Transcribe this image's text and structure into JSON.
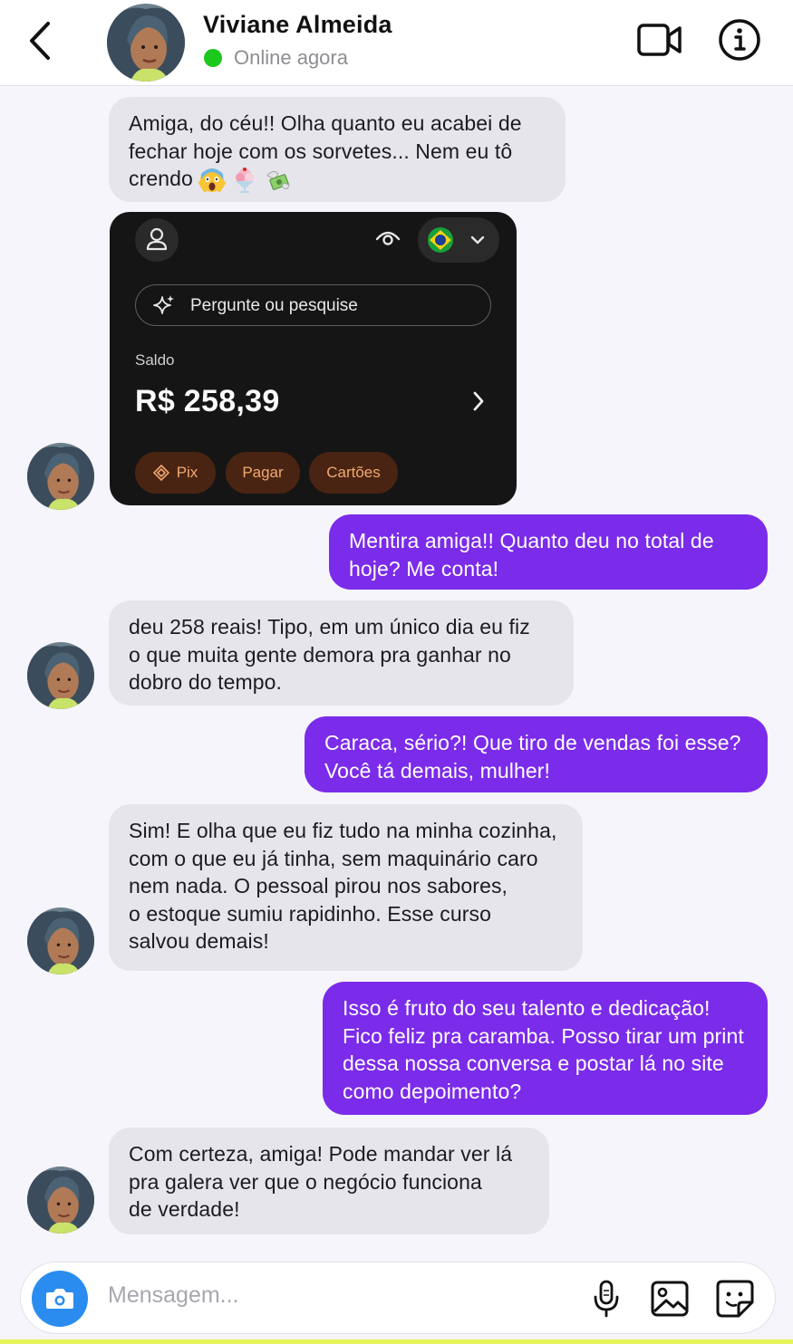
{
  "header": {
    "contact_name": "Viviane Almeida",
    "status": "Online agora",
    "status_color": "#1dc81d"
  },
  "messages": [
    {
      "side": "in",
      "lines": [
        "Amiga, do céu!! Olha quanto eu acabei de",
        "fechar hoje com os sorvetes... Nem eu tô",
        "crendo"
      ],
      "emojis": [
        "scream-emoji",
        "ice-cream-emoji",
        "money-with-wings-emoji"
      ]
    },
    {
      "side": "out",
      "lines": [
        "Mentira amiga!! Quanto deu no total de",
        "hoje? Me conta!"
      ]
    },
    {
      "side": "in",
      "lines": [
        "deu 258 reais! Tipo, em um único dia eu fiz",
        "o que muita gente demora pra ganhar no",
        "dobro do tempo."
      ]
    },
    {
      "side": "out",
      "lines": [
        "Caraca, sério?! Que tiro de vendas foi esse?",
        "Você tá demais, mulher!"
      ]
    },
    {
      "side": "in",
      "lines": [
        "Sim! E olha que eu fiz tudo na minha cozinha,",
        "com o que eu já tinha, sem maquinário caro",
        "nem nada. O pessoal pirou nos sabores,",
        "o estoque sumiu rapidinho. Esse curso",
        "salvou demais!"
      ]
    },
    {
      "side": "out",
      "lines": [
        "Isso é fruto do seu talento e dedicação!",
        "Fico feliz pra caramba. Posso tirar um print",
        "dessa nossa conversa e postar lá no site",
        "como depoimento?"
      ]
    },
    {
      "side": "in",
      "lines": [
        "Com certeza, amiga! Pode mandar ver lá",
        "pra galera ver que o negócio funciona",
        "de verdade!"
      ]
    }
  ],
  "bank_card": {
    "search_placeholder": "Pergunte ou pesquise",
    "saldo_label": "Saldo",
    "saldo_value": "R$ 258,39",
    "buttons": [
      "Pix",
      "Pagar",
      "Cartões"
    ],
    "icons": [
      "user-icon",
      "eye-icon",
      "brazil-flag-icon",
      "chevron-down-icon",
      "sparkle-icon",
      "chevron-right-icon",
      "pix-icon"
    ]
  },
  "composer": {
    "placeholder": "Mensagem..."
  },
  "colors": {
    "outgoing_bubble": "#7b2bea",
    "incoming_bubble": "#e6e5eb",
    "camera_button": "#2b8cf0",
    "bank_card_bg": "#151515",
    "bank_pill_bg": "#4a2412",
    "bank_pill_text": "#f0a870"
  }
}
